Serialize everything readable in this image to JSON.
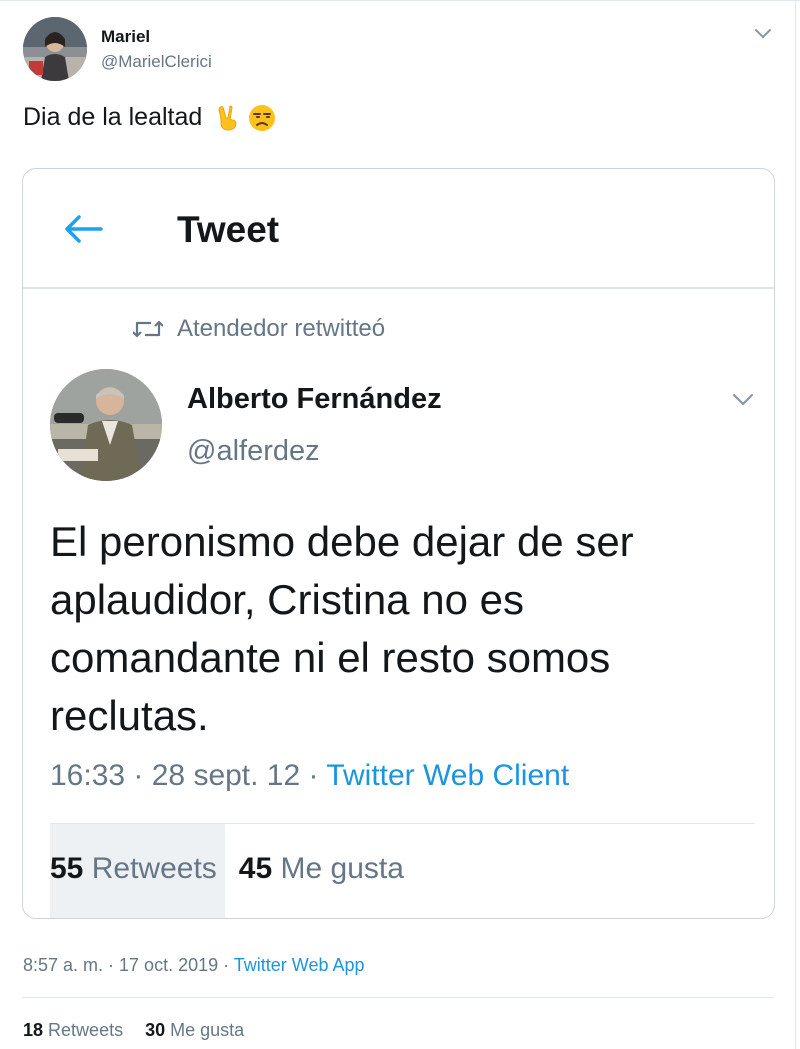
{
  "outer_tweet": {
    "name": "Mariel",
    "handle": "@MarielClerici",
    "text": "Dia de la lealtad",
    "emojis": [
      "victory-hand-emoji",
      "unamused-face-emoji"
    ],
    "timestamp": "8:57 a. m. · 17 oct. 2019 · ",
    "client": "Twitter Web App",
    "retweets_count": "18",
    "retweets_label": "Retweets",
    "likes_count": "30",
    "likes_label": "Me gusta"
  },
  "embedded": {
    "header_title": "Tweet",
    "retweet_notice": "Atendedor retwitteó",
    "name": "Alberto Fernández",
    "handle": "@alferdez",
    "text": "El peronismo debe dejar de ser aplaudidor, Cristina no es comandante ni el resto somos reclutas.",
    "timestamp": "16:33 · 28 sept. 12 · ",
    "client": "Twitter Web Client",
    "retweets_count": "55",
    "retweets_label": "Retweets",
    "likes_count": "45",
    "likes_label": "Me gusta"
  },
  "colors": {
    "accent": "#1b95e0",
    "secondary_text": "#657786",
    "primary_text": "#14171a",
    "border": "#e1e8ed"
  }
}
